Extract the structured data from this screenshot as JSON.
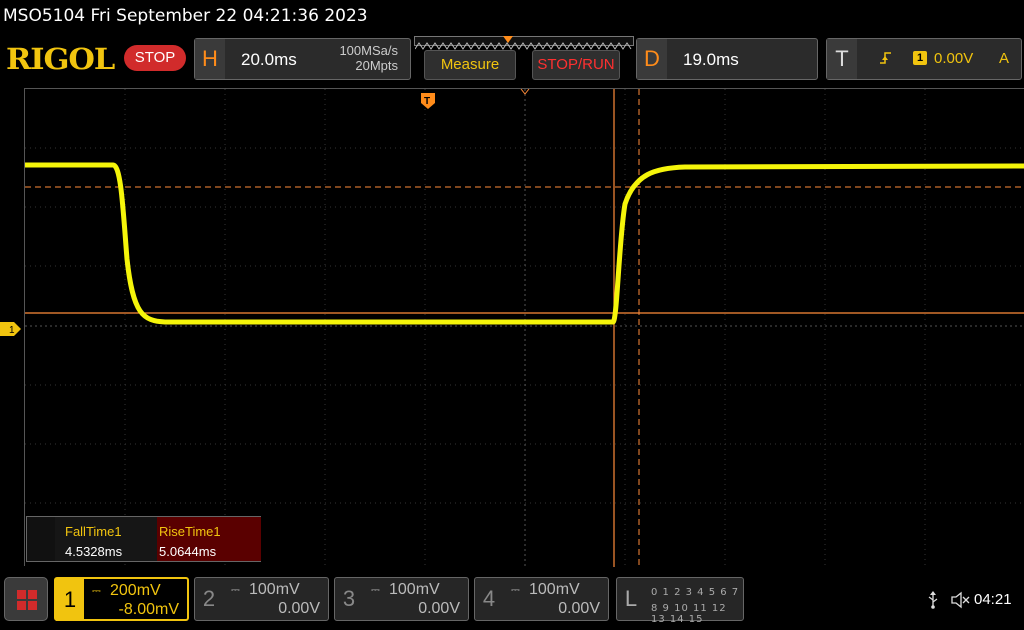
{
  "titlebar": {
    "text": "MSO5104  Fri September 22 04:21:36 2023"
  },
  "toolbar": {
    "logo": "RIGOL",
    "run_state": "STOP",
    "horizontal": {
      "letter": "H",
      "timebase": "20.0ms",
      "sample_rate": "100MSa/s",
      "memory_depth": "20Mpts"
    },
    "measure_label": "Measure",
    "stoprun_label": "STOP/RUN",
    "delay": {
      "letter": "D",
      "value": "19.0ms"
    },
    "trigger": {
      "letter": "T",
      "edge_icon": "rising-edge-icon",
      "source": "1",
      "level": "0.00V",
      "mode": "A"
    }
  },
  "screen": {
    "ch1_marker": "1",
    "trigger_marker": "T",
    "trace_color": "#f5f50a",
    "cursor_color": "#ff8c3a"
  },
  "measurements": [
    {
      "name": "FallTime1",
      "value": "4.5328ms"
    },
    {
      "name": "RiseTime1",
      "value": "5.0644ms"
    }
  ],
  "channels": [
    {
      "num": "1",
      "scale": "200mV",
      "offset": "-8.00mV",
      "active": true,
      "color": "#f1c40f"
    },
    {
      "num": "2",
      "scale": "100mV",
      "offset": "0.00V",
      "active": false
    },
    {
      "num": "3",
      "scale": "100mV",
      "offset": "0.00V",
      "active": false
    },
    {
      "num": "4",
      "scale": "100mV",
      "offset": "0.00V",
      "active": false
    }
  ],
  "logic": {
    "letter": "L",
    "row1": "0 1 2 3   4 5 6 7",
    "row2": "8 9 10 11 12 13 14 15"
  },
  "status": {
    "usb_icon": "usb-icon",
    "sound_icon": "mute-icon",
    "time": "04:21"
  },
  "colors": {
    "brand_yellow": "#f1c40f",
    "accent_orange": "#ff8c1a",
    "stop_red": "#d12b2b"
  }
}
